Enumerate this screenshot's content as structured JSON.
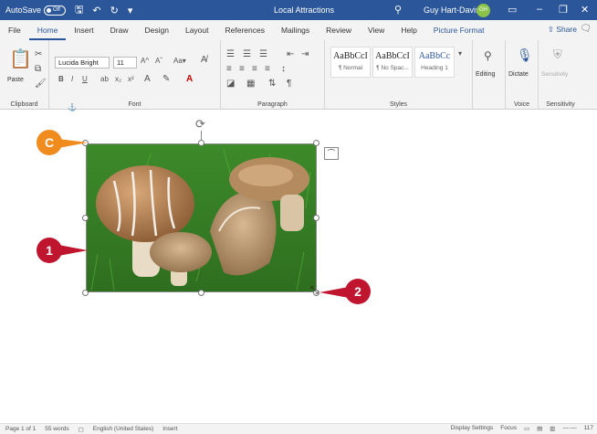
{
  "titlebar": {
    "autosave": "AutoSave",
    "toggle": "Off",
    "doc_title": "Local Attractions",
    "user": "Guy Hart-Davis",
    "initials": "GH"
  },
  "tabs": [
    "File",
    "Home",
    "Insert",
    "Draw",
    "Design",
    "Layout",
    "References",
    "Mailings",
    "Review",
    "View",
    "Help",
    "Picture Format"
  ],
  "share": "Share",
  "ribbon": {
    "clipboard": "Clipboard",
    "paste": "Paste",
    "font_group": "Font",
    "font_name": "Lucida Bright",
    "font_size": "11",
    "paragraph": "Paragraph",
    "styles": "Styles",
    "style_normal_preview": "AaBbCcI",
    "style_normal": "¶ Normal",
    "style_nospacing_preview": "AaBbCcI",
    "style_nospacing": "¶ No Spac...",
    "style_h1_preview": "AaBbCc",
    "style_h1": "Heading 1",
    "editing": "Editing",
    "dictate": "Dictate",
    "voice": "Voice",
    "sensitivity": "Sensitivity",
    "sensitivity_group": "Sensitivity"
  },
  "callouts": {
    "c": "C",
    "one": "1",
    "two": "2"
  },
  "status": {
    "page": "Page 1 of 1",
    "words": "55 words",
    "language": "English (United States)",
    "mode": "Insert",
    "display": "Display Settings",
    "focus": "Focus",
    "zoom": "117"
  }
}
